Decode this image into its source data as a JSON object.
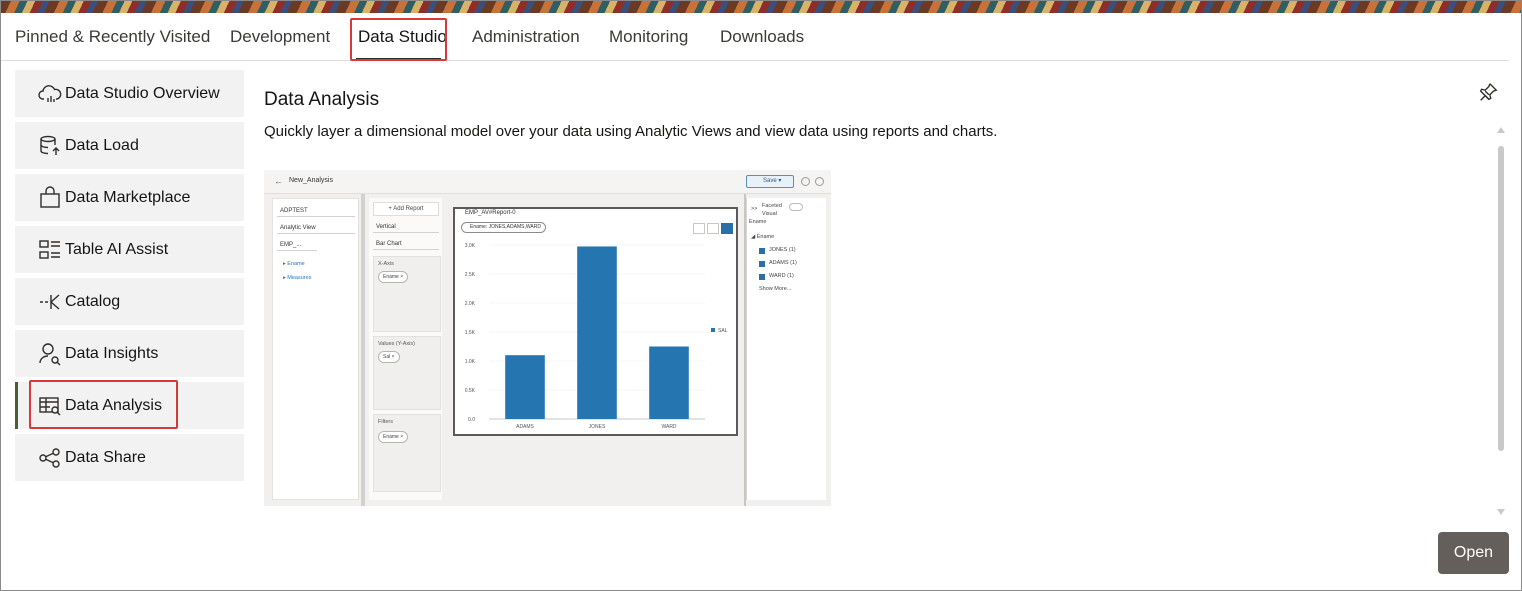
{
  "top_tabs": [
    {
      "label": "Pinned & Recently Visited",
      "selected": false
    },
    {
      "label": "Development",
      "selected": false
    },
    {
      "label": "Data Studio",
      "selected": true
    },
    {
      "label": "Administration",
      "selected": false
    },
    {
      "label": "Monitoring",
      "selected": false
    },
    {
      "label": "Downloads",
      "selected": false
    }
  ],
  "sidebar": {
    "items": [
      {
        "label": "Data Studio Overview",
        "icon": "cloud-chart-icon"
      },
      {
        "label": "Data Load",
        "icon": "database-upload-icon"
      },
      {
        "label": "Data Marketplace",
        "icon": "shopping-bag-icon"
      },
      {
        "label": "Table AI Assist",
        "icon": "table-ai-icon"
      },
      {
        "label": "Catalog",
        "icon": "catalog-icon"
      },
      {
        "label": "Data Insights",
        "icon": "person-search-icon"
      },
      {
        "label": "Data Analysis",
        "icon": "table-search-icon",
        "selected": true
      },
      {
        "label": "Data Share",
        "icon": "share-nodes-icon"
      }
    ],
    "selected_accent": "#4a5c36"
  },
  "main": {
    "title": "Data Analysis",
    "description": "Quickly layer a dimensional model over your data using Analytic Views and view data using reports and charts.",
    "open_label": "Open",
    "pin_icon": "pin-icon"
  },
  "preview": {
    "analysis_name": "New_Analysis",
    "save_label": "Save",
    "schema": "ADPTEST",
    "source_type": "Analytic View",
    "view_name": "EMP_...",
    "tree": [
      "Ename",
      "Measures"
    ],
    "add_report": "+ Add Report",
    "orientation": "Vertical",
    "chart_type": "Bar Chart",
    "xaxis_label": "X-Axis",
    "xaxis_chip": "Ename ×",
    "values_label": "Values (Y-Axis)",
    "values_chip": "Sal ×",
    "filters_label": "Filters",
    "filters_chip": "Ename ×",
    "report_title": "EMP_AV#Report-0",
    "filter_chip": "Ename: JONES,ADAMS,WARD",
    "facet_label_1": "Faceted",
    "facet_label_2": "Visual",
    "facet_field": "Ename",
    "facet_group": "Ename",
    "facet_values": [
      "JONES (1)",
      "ADAMS (1)",
      "WARD (1)"
    ],
    "show_more": "Show More...",
    "expand_icon": ">>",
    "chart_data": {
      "type": "bar",
      "categories": [
        "ADAMS",
        "JONES",
        "WARD"
      ],
      "values": [
        1100,
        2975,
        1250
      ],
      "series_name": "SAL",
      "ylim": [
        0,
        3000
      ],
      "yticks": [
        "0.0",
        "0.5K",
        "1.0K",
        "1.5K",
        "2.0K",
        "2.5K",
        "3.0K"
      ],
      "bar_color": "#2475b0",
      "legend": "right"
    }
  },
  "colors": {
    "highlight_outline": "#d9383a",
    "open_button_bg": "#645f5a",
    "sidebar_bg": "#f2f2f2"
  }
}
